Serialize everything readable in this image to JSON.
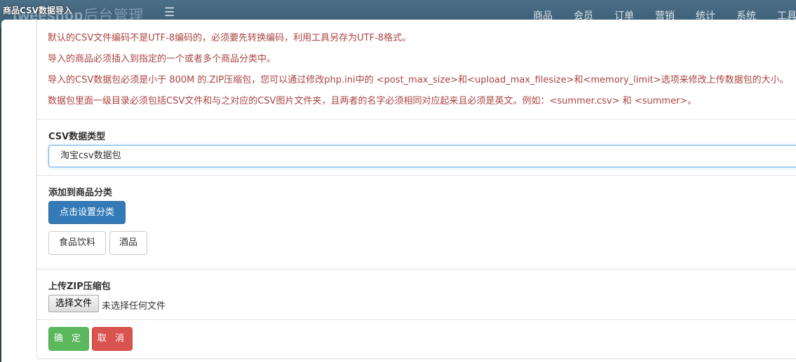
{
  "navbar": {
    "brand_bold": "tweeshop",
    "brand_rest": "后台管理",
    "menu_icon": "hamburger-icon",
    "menu": [
      "商品",
      "会员",
      "订单",
      "营销",
      "统计",
      "系统",
      "工具"
    ]
  },
  "modal": {
    "title": "商品CSV数据导入",
    "notes": [
      "默认的CSV文件编码不是UTF-8编码的，必须要先转换编码，利用工具另存为UTF-8格式。",
      "导入的商品必须插入到指定的一个或者多个商品分类中。",
      "导入的CSV数据包必须是小于 800M 的.ZIP压缩包，您可以通过修改php.ini中的 <post_max_size>和<upload_max_filesize>和<memory_limit>选项来修改上传数据包的大小。",
      "数据包里面一级目录必须包括CSV文件和与之对应的CSV图片文件夹，且两者的名字必须相同对应起来且必须是英文。例如：<summer.csv> 和 <summer>。"
    ],
    "csv_type": {
      "label": "CSV数据类型",
      "selected": "淘宝csv数据包"
    },
    "category": {
      "label": "添加到商品分类",
      "set_button": "点击设置分类",
      "chips": [
        "食品饮料",
        "酒品"
      ]
    },
    "upload": {
      "label": "上传ZIP压缩包",
      "choose_button": "选择文件",
      "status": "未选择任何文件"
    },
    "actions": {
      "confirm": "确 定",
      "cancel": "取 消"
    }
  },
  "colors": {
    "note_text": "#a94442",
    "primary": "#337ab7",
    "success": "#5cb85c",
    "danger": "#d9534f",
    "navbar": "#3f6077"
  }
}
